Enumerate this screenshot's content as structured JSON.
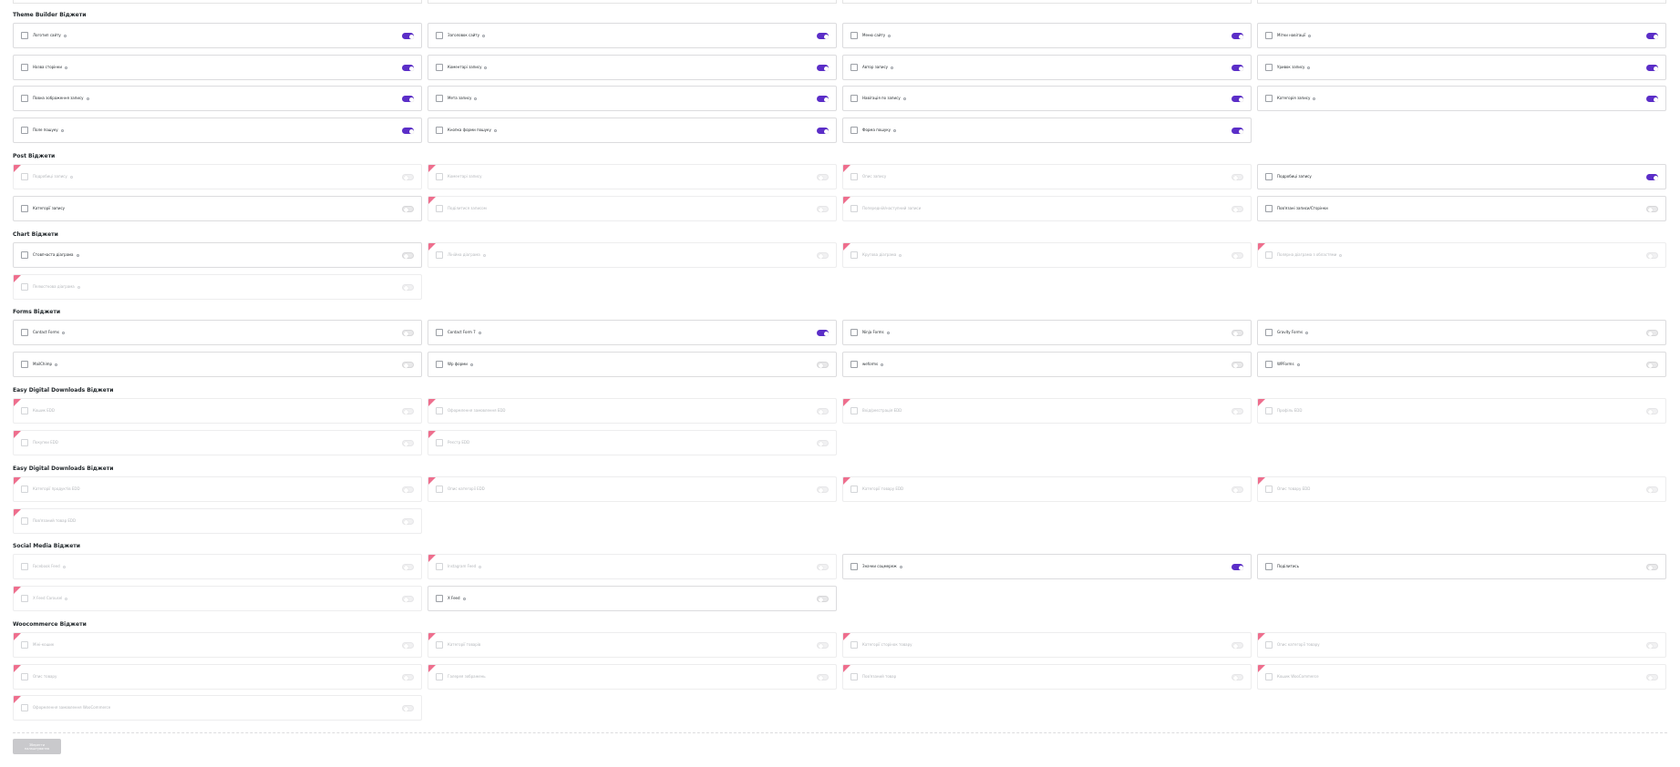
{
  "colors": {
    "accent": "#5b2ec8",
    "pro_badge": "#ee6e8d",
    "border": "#dcdcde"
  },
  "sections": [
    {
      "title": "Theme Builder Віджети",
      "items": [
        {
          "label": "Логотип сайту",
          "icon": "logo-icon",
          "on": true,
          "pro": false,
          "enabled": true,
          "help": true
        },
        {
          "label": "Заголовок сайту",
          "icon": "title-icon",
          "on": true,
          "pro": false,
          "enabled": true,
          "help": true
        },
        {
          "label": "Меню сайту",
          "icon": "menu-icon",
          "on": true,
          "pro": false,
          "enabled": true,
          "help": true
        },
        {
          "label": "Мітки навігації",
          "icon": "tag-icon",
          "on": true,
          "pro": false,
          "enabled": true,
          "help": true
        },
        {
          "label": "Назва сторінки",
          "icon": "page-title-icon",
          "on": true,
          "pro": false,
          "enabled": true,
          "help": true
        },
        {
          "label": "Коментарі запису",
          "icon": "comments-icon",
          "on": true,
          "pro": false,
          "enabled": true,
          "help": true
        },
        {
          "label": "Автор запису",
          "icon": "author-icon",
          "on": true,
          "pro": false,
          "enabled": true,
          "help": true
        },
        {
          "label": "Уривок запису",
          "icon": "excerpt-icon",
          "on": true,
          "pro": false,
          "enabled": true,
          "help": true
        },
        {
          "label": "Повна зображення запису",
          "icon": "image-icon",
          "on": true,
          "pro": false,
          "enabled": true,
          "help": true
        },
        {
          "label": "Мета запису",
          "icon": "meta-icon",
          "on": true,
          "pro": false,
          "enabled": true,
          "help": true
        },
        {
          "label": "Навігація по запису",
          "icon": "navigation-icon",
          "on": true,
          "pro": false,
          "enabled": true,
          "help": true
        },
        {
          "label": "Категорія запису",
          "icon": "category-icon",
          "on": true,
          "pro": false,
          "enabled": true,
          "help": true
        },
        {
          "label": "Поле пошуку",
          "icon": "search-icon",
          "on": true,
          "pro": false,
          "enabled": true,
          "help": true
        },
        {
          "label": "Кнопка форми пошуку",
          "icon": "search-button-icon",
          "on": true,
          "pro": false,
          "enabled": true,
          "help": true
        },
        {
          "label": "Форма пошуку",
          "icon": "search-form-icon",
          "on": true,
          "pro": false,
          "enabled": true,
          "help": true
        }
      ]
    },
    {
      "title": "Post Віджети",
      "items": [
        {
          "label": "Подробиці запису",
          "icon": "details-icon",
          "on": false,
          "pro": true,
          "enabled": false,
          "help": true
        },
        {
          "label": "Коментарі запису",
          "icon": "comments-icon",
          "on": false,
          "pro": true,
          "enabled": false,
          "help": false
        },
        {
          "label": "Опис запису",
          "icon": "description-icon",
          "on": false,
          "pro": true,
          "enabled": false,
          "help": false
        },
        {
          "label": "Подробиці запису",
          "icon": "details-icon",
          "on": true,
          "pro": false,
          "enabled": true,
          "help": false
        },
        {
          "label": "Категорії запису",
          "icon": "category-icon",
          "on": false,
          "pro": false,
          "enabled": true,
          "help": false
        },
        {
          "label": "Поділитися записом",
          "icon": "share-icon",
          "on": false,
          "pro": true,
          "enabled": false,
          "help": false
        },
        {
          "label": "Попередній/наступний записи",
          "icon": "arrows-icon",
          "on": false,
          "pro": true,
          "enabled": false,
          "help": false
        },
        {
          "label": "Пов'язані записи/Сторінки",
          "icon": "related-icon",
          "on": false,
          "pro": false,
          "enabled": true,
          "help": false
        }
      ]
    },
    {
      "title": "Chart Віджети",
      "items": [
        {
          "label": "Стовпчаста діаграма",
          "icon": "bar-chart-icon",
          "on": false,
          "pro": false,
          "enabled": true,
          "help": true
        },
        {
          "label": "Лінійна діаграма",
          "icon": "line-chart-icon",
          "on": false,
          "pro": true,
          "enabled": false,
          "help": true
        },
        {
          "label": "Кругова діаграма",
          "icon": "pie-chart-icon",
          "on": false,
          "pro": true,
          "enabled": false,
          "help": true
        },
        {
          "label": "Полярна діаграма з областями",
          "icon": "polar-chart-icon",
          "on": false,
          "pro": true,
          "enabled": false,
          "help": true
        },
        {
          "label": "Пелюсткова діаграма",
          "icon": "radar-chart-icon",
          "on": false,
          "pro": true,
          "enabled": false,
          "help": true
        }
      ]
    },
    {
      "title": "Forms Віджети",
      "items": [
        {
          "label": "Contact Forms",
          "icon": "form-icon",
          "on": false,
          "pro": false,
          "enabled": true,
          "help": true
        },
        {
          "label": "Contact Form 7",
          "icon": "form-icon",
          "on": true,
          "pro": false,
          "enabled": true,
          "help": true
        },
        {
          "label": "Ninja Forms",
          "icon": "form-icon",
          "on": false,
          "pro": false,
          "enabled": true,
          "help": true
        },
        {
          "label": "Gravity Forms",
          "icon": "form-icon",
          "on": false,
          "pro": false,
          "enabled": true,
          "help": true
        },
        {
          "label": "MailChimp",
          "icon": "mailchimp-icon",
          "on": false,
          "pro": false,
          "enabled": true,
          "help": true
        },
        {
          "label": "Wp форми",
          "icon": "form-icon",
          "on": false,
          "pro": false,
          "enabled": true,
          "help": true
        },
        {
          "label": "weforms",
          "icon": "form-icon",
          "on": false,
          "pro": false,
          "enabled": true,
          "help": true
        },
        {
          "label": "WPForms",
          "icon": "form-icon",
          "on": false,
          "pro": false,
          "enabled": true,
          "help": true
        }
      ]
    },
    {
      "title": "Easy Digital Downloads Віджети",
      "items": [
        {
          "label": "Кошик EDD",
          "icon": "cart-icon",
          "on": false,
          "pro": true,
          "enabled": false,
          "help": false
        },
        {
          "label": "Оформлення замовлення EDD",
          "icon": "checkout-icon",
          "on": false,
          "pro": true,
          "enabled": false,
          "help": false
        },
        {
          "label": "Вхід/реєстрація EDD",
          "icon": "login-icon",
          "on": false,
          "pro": true,
          "enabled": false,
          "help": false
        },
        {
          "label": "Профіль EDD",
          "icon": "profile-icon",
          "on": false,
          "pro": true,
          "enabled": false,
          "help": false
        },
        {
          "label": "Покупки EDD",
          "icon": "purchases-icon",
          "on": false,
          "pro": true,
          "enabled": false,
          "help": false
        },
        {
          "label": "Реєстр EDD",
          "icon": "register-icon",
          "on": false,
          "pro": true,
          "enabled": false,
          "help": false
        }
      ]
    },
    {
      "title": "Easy Digital Downloads Віджети",
      "items": [
        {
          "label": "Категорії продуктів EDD",
          "icon": "category-icon",
          "on": false,
          "pro": true,
          "enabled": false,
          "help": false
        },
        {
          "label": "Опис категорії EDD",
          "icon": "description-icon",
          "on": false,
          "pro": true,
          "enabled": false,
          "help": false
        },
        {
          "label": "Категорії товару EDD",
          "icon": "category-icon",
          "on": false,
          "pro": true,
          "enabled": false,
          "help": false
        },
        {
          "label": "Опис товару EDD",
          "icon": "product-icon",
          "on": false,
          "pro": true,
          "enabled": false,
          "help": false
        },
        {
          "label": "Пов'язаний товар EDD",
          "icon": "related-icon",
          "on": false,
          "pro": true,
          "enabled": false,
          "help": false
        }
      ]
    },
    {
      "title": "Social Media Віджети",
      "items": [
        {
          "label": "Facebook Feed",
          "icon": "facebook-icon",
          "on": false,
          "pro": false,
          "enabled": false,
          "help": true
        },
        {
          "label": "Instagram Feed",
          "icon": "instagram-icon",
          "on": false,
          "pro": true,
          "enabled": false,
          "help": true
        },
        {
          "label": "Значки соцмереж",
          "icon": "social-icon",
          "on": true,
          "pro": false,
          "enabled": true,
          "help": true
        },
        {
          "label": "Поділитись",
          "icon": "share-icon",
          "on": false,
          "pro": false,
          "enabled": true,
          "help": false
        },
        {
          "label": "X Feed Carousel",
          "icon": "x-icon",
          "on": false,
          "pro": true,
          "enabled": false,
          "help": true
        },
        {
          "label": "X Feed",
          "icon": "x-icon",
          "on": false,
          "pro": false,
          "enabled": true,
          "help": true
        }
      ]
    },
    {
      "title": "Woocommerce Віджети",
      "items": [
        {
          "label": "Міні-кошик",
          "icon": "cart-icon",
          "on": false,
          "pro": true,
          "enabled": false,
          "help": false
        },
        {
          "label": "Категорії товарів",
          "icon": "category-icon",
          "on": false,
          "pro": true,
          "enabled": false,
          "help": false
        },
        {
          "label": "Категорії сторінок товару",
          "icon": "category-icon",
          "on": false,
          "pro": true,
          "enabled": false,
          "help": false
        },
        {
          "label": "Опис категорії товару",
          "icon": "description-icon",
          "on": false,
          "pro": true,
          "enabled": false,
          "help": false
        },
        {
          "label": "Опис товару",
          "icon": "product-icon",
          "on": false,
          "pro": true,
          "enabled": false,
          "help": false
        },
        {
          "label": "Галерея зображень",
          "icon": "gallery-icon",
          "on": false,
          "pro": true,
          "enabled": false,
          "help": false
        },
        {
          "label": "Пов'язаний товар",
          "icon": "related-icon",
          "on": false,
          "pro": true,
          "enabled": false,
          "help": false
        },
        {
          "label": "Кошик WooCommerce",
          "icon": "cart-icon",
          "on": false,
          "pro": true,
          "enabled": false,
          "help": false
        },
        {
          "label": "Оформлення замовлення WooCommerce",
          "icon": "checkout-icon",
          "on": false,
          "pro": true,
          "enabled": false,
          "help": false
        }
      ]
    }
  ],
  "footer": {
    "save_label": "Зберегти налаштування"
  }
}
